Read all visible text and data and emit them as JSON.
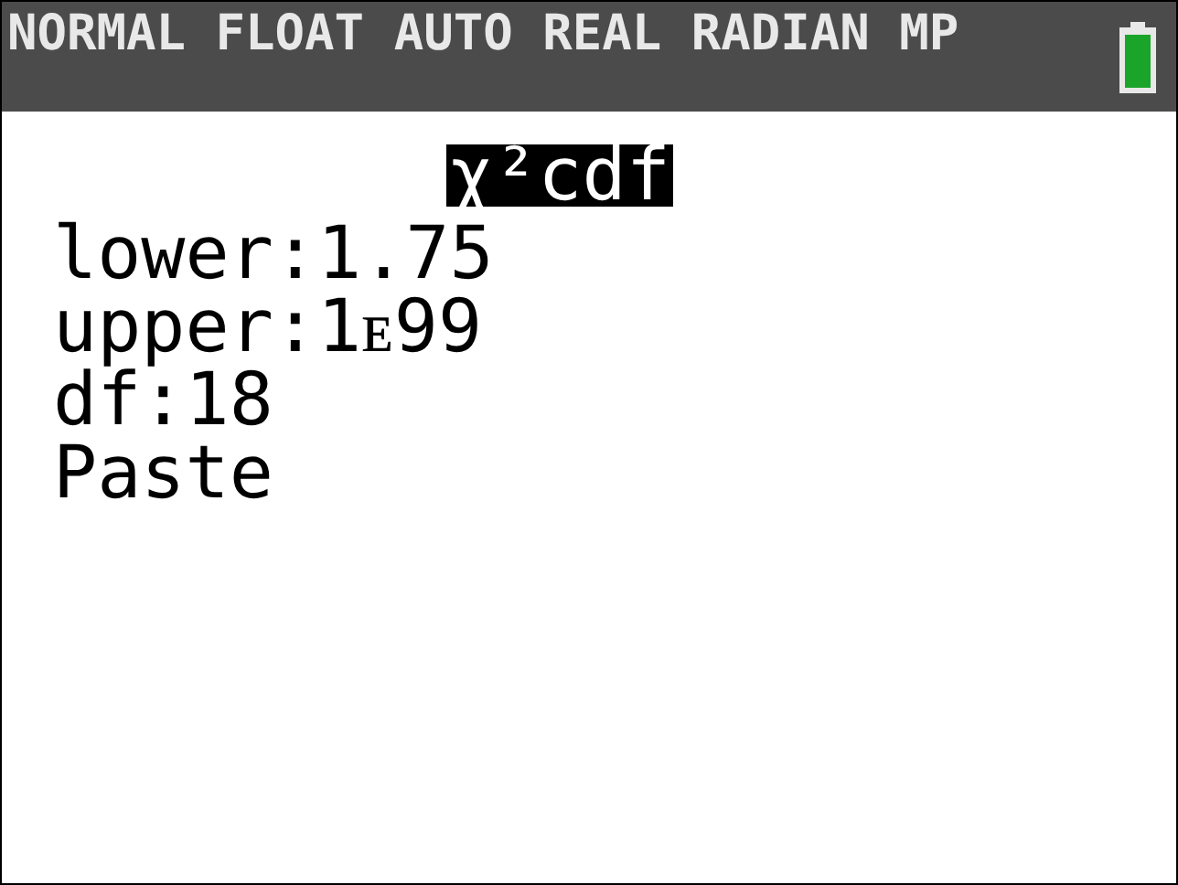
{
  "status_bar": {
    "modes": "NORMAL FLOAT AUTO REAL RADIAN MP"
  },
  "menu": {
    "title": "χ²cdf",
    "fields": [
      {
        "label": "lower:",
        "value": "1.75"
      },
      {
        "label": "upper:",
        "value": "1ᴇ99"
      },
      {
        "label": "df:",
        "value": "18"
      }
    ],
    "actions": [
      "Paste"
    ]
  }
}
